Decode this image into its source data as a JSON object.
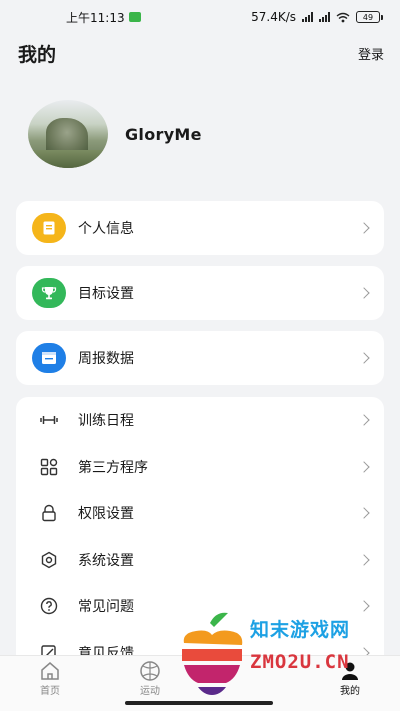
{
  "status_bar": {
    "time": "上午11:13",
    "network_speed": "57.4K/s",
    "battery": "49"
  },
  "header": {
    "title": "我的",
    "login": "登录"
  },
  "profile": {
    "username": "GloryMe"
  },
  "cards": [
    {
      "label": "个人信息",
      "icon": "document-icon",
      "color": "#f5b51a"
    },
    {
      "label": "目标设置",
      "icon": "trophy-icon",
      "color": "#33b85a"
    },
    {
      "label": "周报数据",
      "icon": "report-icon",
      "color": "#1f7fe6"
    }
  ],
  "menu": [
    {
      "label": "训练日程",
      "icon": "dumbbell-icon"
    },
    {
      "label": "第三方程序",
      "icon": "apps-icon"
    },
    {
      "label": "权限设置",
      "icon": "lock-icon"
    },
    {
      "label": "系统设置",
      "icon": "gear-icon"
    },
    {
      "label": "常见问题",
      "icon": "question-icon"
    },
    {
      "label": "意见反馈",
      "icon": "feedback-icon"
    }
  ],
  "tabs": [
    {
      "label": "首页",
      "icon": "home-icon"
    },
    {
      "label": "运动",
      "icon": "sport-ball-icon"
    },
    {
      "label": "",
      "icon": "center-icon"
    },
    {
      "label": "我的",
      "icon": "person-icon"
    }
  ],
  "watermark": {
    "line1": "知末游戏网",
    "line2": "ZMO2U.CN"
  }
}
